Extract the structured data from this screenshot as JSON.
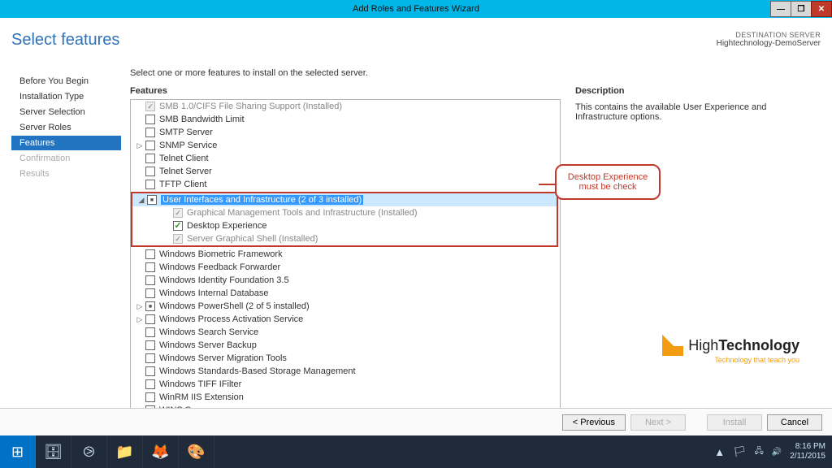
{
  "titlebar": {
    "title": "Add Roles and Features Wizard"
  },
  "page": {
    "heading": "Select features",
    "destination_label": "DESTINATION SERVER",
    "destination_value": "Hightechnology-DemoServer",
    "intro": "Select one or more features to install on the selected server.",
    "features_label": "Features",
    "description_label": "Description",
    "description_text": "This contains the available User Experience and Infrastructure options."
  },
  "steps": [
    {
      "label": "Before You Begin",
      "state": "normal"
    },
    {
      "label": "Installation Type",
      "state": "normal"
    },
    {
      "label": "Server Selection",
      "state": "normal"
    },
    {
      "label": "Server Roles",
      "state": "normal"
    },
    {
      "label": "Features",
      "state": "active"
    },
    {
      "label": "Confirmation",
      "state": "disabled"
    },
    {
      "label": "Results",
      "state": "disabled"
    }
  ],
  "features": {
    "top_installed": "SMB 1.0/CIFS File Sharing Support (Installed)",
    "smb_bandwidth": "SMB Bandwidth Limit",
    "smtp": "SMTP Server",
    "snmp": "SNMP Service",
    "telnet_client": "Telnet Client",
    "telnet_server": "Telnet Server",
    "tftp": "TFTP Client",
    "ui_infra": "User Interfaces and Infrastructure (2 of 3 installed)",
    "gmt": "Graphical Management Tools and Infrastructure (Installed)",
    "desktop_exp": "Desktop Experience",
    "sgs": "Server Graphical Shell (Installed)",
    "biometric": "Windows Biometric Framework",
    "feedback": "Windows Feedback Forwarder",
    "wif": "Windows Identity Foundation 3.5",
    "widb": "Windows Internal Database",
    "ps": "Windows PowerShell (2 of 5 installed)",
    "wpas": "Windows Process Activation Service",
    "search": "Windows Search Service",
    "backup": "Windows Server Backup",
    "migration": "Windows Server Migration Tools",
    "storage": "Windows Standards-Based Storage Management",
    "tiff": "Windows TIFF IFilter",
    "winrm": "WinRM IIS Extension",
    "wins": "WINS Server"
  },
  "callout": {
    "line1": "Desktop Experience",
    "line2": "must be check"
  },
  "buttons": {
    "prev": "< Previous",
    "next": "Next >",
    "install": "Install",
    "cancel": "Cancel"
  },
  "logo": {
    "main_light": "High",
    "main_bold": "Technology",
    "tag": "Technology that teach you"
  },
  "tray": {
    "time": "8:16 PM",
    "date": "2/11/2015"
  }
}
